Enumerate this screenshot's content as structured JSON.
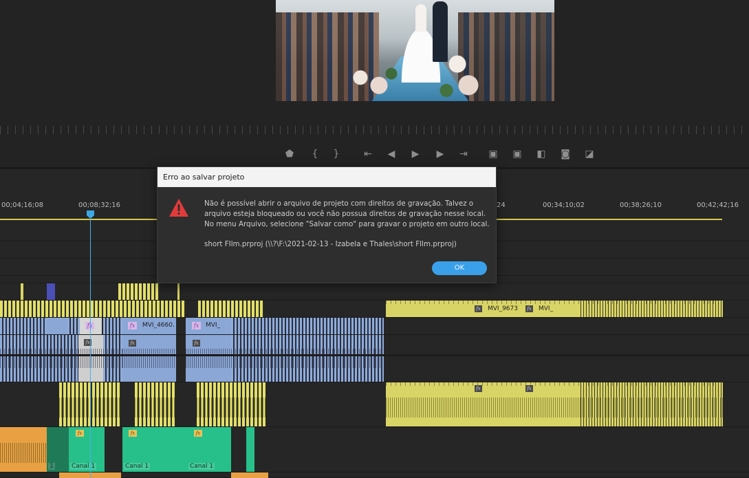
{
  "dialog": {
    "title": "Erro ao salvar projeto",
    "message_line1": "Não é possível abrir o arquivo de projeto com direitos de gravação. Talvez o",
    "message_line2": "arquivo esteja bloqueado ou você não possua direitos de gravação nesse local.",
    "message_line3": "No menu Arquivo, selecione \"Salvar como\" para gravar o projeto em outro local.",
    "path": "short FIlm.prproj (\\\\?\\F:\\2021-02-13 - Izabela e Thales\\short FIlm.prproj)",
    "ok_label": "OK",
    "icon": "warning-icon"
  },
  "timeline": {
    "timecodes": [
      "00;04;16;08",
      "00;08;32;16",
      "24",
      "00;34;10;02",
      "00;38;26;10",
      "00;42;42;16"
    ]
  },
  "clips": {
    "v1_a": "MVI_4660.",
    "v1_b": "MVI_",
    "v2_a": "MVI_9673",
    "v2_b": "MVI_",
    "fx": "fx",
    "canal_1": "Canal 1",
    "canal_2": "Canal 1",
    "canal_3": "Canal 1",
    "channel_short": "1"
  },
  "colors": {
    "accent": "#3aa0ea",
    "playhead": "#49b0f0",
    "clip_yellow": "#d9d466",
    "clip_blue": "#8aa7d6",
    "clip_green": "#27c08b",
    "clip_orange": "#e9a043",
    "warning": "#e23b3b"
  },
  "transport": {
    "icons": [
      "add-marker-icon",
      "mark-in-icon",
      "mark-out-icon",
      "go-to-in-icon",
      "step-back-icon",
      "play-icon",
      "step-forward-icon",
      "go-to-out-icon",
      "lift-icon",
      "extract-icon",
      "insert-icon",
      "export-frame-icon",
      "compare-icon"
    ]
  }
}
